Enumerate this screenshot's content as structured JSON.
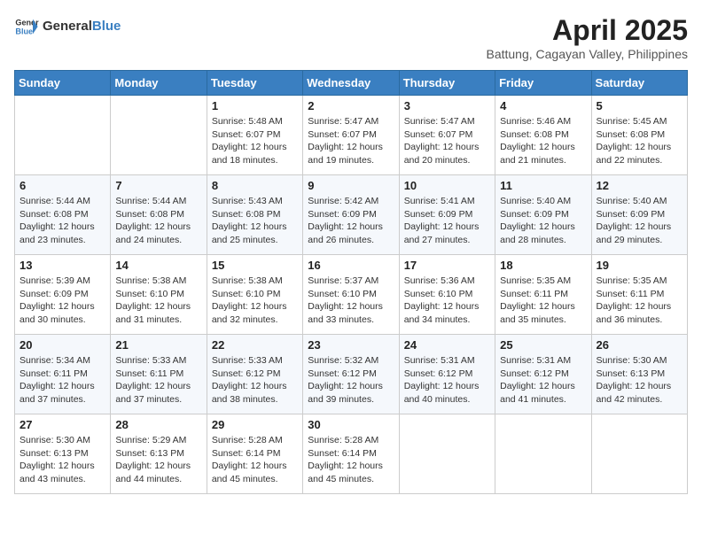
{
  "header": {
    "logo_general": "General",
    "logo_blue": "Blue",
    "month_title": "April 2025",
    "location": "Battung, Cagayan Valley, Philippines"
  },
  "days_of_week": [
    "Sunday",
    "Monday",
    "Tuesday",
    "Wednesday",
    "Thursday",
    "Friday",
    "Saturday"
  ],
  "weeks": [
    [
      {
        "day": "",
        "sunrise": "",
        "sunset": "",
        "daylight": ""
      },
      {
        "day": "",
        "sunrise": "",
        "sunset": "",
        "daylight": ""
      },
      {
        "day": "1",
        "sunrise": "Sunrise: 5:48 AM",
        "sunset": "Sunset: 6:07 PM",
        "daylight": "Daylight: 12 hours and 18 minutes."
      },
      {
        "day": "2",
        "sunrise": "Sunrise: 5:47 AM",
        "sunset": "Sunset: 6:07 PM",
        "daylight": "Daylight: 12 hours and 19 minutes."
      },
      {
        "day": "3",
        "sunrise": "Sunrise: 5:47 AM",
        "sunset": "Sunset: 6:07 PM",
        "daylight": "Daylight: 12 hours and 20 minutes."
      },
      {
        "day": "4",
        "sunrise": "Sunrise: 5:46 AM",
        "sunset": "Sunset: 6:08 PM",
        "daylight": "Daylight: 12 hours and 21 minutes."
      },
      {
        "day": "5",
        "sunrise": "Sunrise: 5:45 AM",
        "sunset": "Sunset: 6:08 PM",
        "daylight": "Daylight: 12 hours and 22 minutes."
      }
    ],
    [
      {
        "day": "6",
        "sunrise": "Sunrise: 5:44 AM",
        "sunset": "Sunset: 6:08 PM",
        "daylight": "Daylight: 12 hours and 23 minutes."
      },
      {
        "day": "7",
        "sunrise": "Sunrise: 5:44 AM",
        "sunset": "Sunset: 6:08 PM",
        "daylight": "Daylight: 12 hours and 24 minutes."
      },
      {
        "day": "8",
        "sunrise": "Sunrise: 5:43 AM",
        "sunset": "Sunset: 6:08 PM",
        "daylight": "Daylight: 12 hours and 25 minutes."
      },
      {
        "day": "9",
        "sunrise": "Sunrise: 5:42 AM",
        "sunset": "Sunset: 6:09 PM",
        "daylight": "Daylight: 12 hours and 26 minutes."
      },
      {
        "day": "10",
        "sunrise": "Sunrise: 5:41 AM",
        "sunset": "Sunset: 6:09 PM",
        "daylight": "Daylight: 12 hours and 27 minutes."
      },
      {
        "day": "11",
        "sunrise": "Sunrise: 5:40 AM",
        "sunset": "Sunset: 6:09 PM",
        "daylight": "Daylight: 12 hours and 28 minutes."
      },
      {
        "day": "12",
        "sunrise": "Sunrise: 5:40 AM",
        "sunset": "Sunset: 6:09 PM",
        "daylight": "Daylight: 12 hours and 29 minutes."
      }
    ],
    [
      {
        "day": "13",
        "sunrise": "Sunrise: 5:39 AM",
        "sunset": "Sunset: 6:09 PM",
        "daylight": "Daylight: 12 hours and 30 minutes."
      },
      {
        "day": "14",
        "sunrise": "Sunrise: 5:38 AM",
        "sunset": "Sunset: 6:10 PM",
        "daylight": "Daylight: 12 hours and 31 minutes."
      },
      {
        "day": "15",
        "sunrise": "Sunrise: 5:38 AM",
        "sunset": "Sunset: 6:10 PM",
        "daylight": "Daylight: 12 hours and 32 minutes."
      },
      {
        "day": "16",
        "sunrise": "Sunrise: 5:37 AM",
        "sunset": "Sunset: 6:10 PM",
        "daylight": "Daylight: 12 hours and 33 minutes."
      },
      {
        "day": "17",
        "sunrise": "Sunrise: 5:36 AM",
        "sunset": "Sunset: 6:10 PM",
        "daylight": "Daylight: 12 hours and 34 minutes."
      },
      {
        "day": "18",
        "sunrise": "Sunrise: 5:35 AM",
        "sunset": "Sunset: 6:11 PM",
        "daylight": "Daylight: 12 hours and 35 minutes."
      },
      {
        "day": "19",
        "sunrise": "Sunrise: 5:35 AM",
        "sunset": "Sunset: 6:11 PM",
        "daylight": "Daylight: 12 hours and 36 minutes."
      }
    ],
    [
      {
        "day": "20",
        "sunrise": "Sunrise: 5:34 AM",
        "sunset": "Sunset: 6:11 PM",
        "daylight": "Daylight: 12 hours and 37 minutes."
      },
      {
        "day": "21",
        "sunrise": "Sunrise: 5:33 AM",
        "sunset": "Sunset: 6:11 PM",
        "daylight": "Daylight: 12 hours and 37 minutes."
      },
      {
        "day": "22",
        "sunrise": "Sunrise: 5:33 AM",
        "sunset": "Sunset: 6:12 PM",
        "daylight": "Daylight: 12 hours and 38 minutes."
      },
      {
        "day": "23",
        "sunrise": "Sunrise: 5:32 AM",
        "sunset": "Sunset: 6:12 PM",
        "daylight": "Daylight: 12 hours and 39 minutes."
      },
      {
        "day": "24",
        "sunrise": "Sunrise: 5:31 AM",
        "sunset": "Sunset: 6:12 PM",
        "daylight": "Daylight: 12 hours and 40 minutes."
      },
      {
        "day": "25",
        "sunrise": "Sunrise: 5:31 AM",
        "sunset": "Sunset: 6:12 PM",
        "daylight": "Daylight: 12 hours and 41 minutes."
      },
      {
        "day": "26",
        "sunrise": "Sunrise: 5:30 AM",
        "sunset": "Sunset: 6:13 PM",
        "daylight": "Daylight: 12 hours and 42 minutes."
      }
    ],
    [
      {
        "day": "27",
        "sunrise": "Sunrise: 5:30 AM",
        "sunset": "Sunset: 6:13 PM",
        "daylight": "Daylight: 12 hours and 43 minutes."
      },
      {
        "day": "28",
        "sunrise": "Sunrise: 5:29 AM",
        "sunset": "Sunset: 6:13 PM",
        "daylight": "Daylight: 12 hours and 44 minutes."
      },
      {
        "day": "29",
        "sunrise": "Sunrise: 5:28 AM",
        "sunset": "Sunset: 6:14 PM",
        "daylight": "Daylight: 12 hours and 45 minutes."
      },
      {
        "day": "30",
        "sunrise": "Sunrise: 5:28 AM",
        "sunset": "Sunset: 6:14 PM",
        "daylight": "Daylight: 12 hours and 45 minutes."
      },
      {
        "day": "",
        "sunrise": "",
        "sunset": "",
        "daylight": ""
      },
      {
        "day": "",
        "sunrise": "",
        "sunset": "",
        "daylight": ""
      },
      {
        "day": "",
        "sunrise": "",
        "sunset": "",
        "daylight": ""
      }
    ]
  ]
}
